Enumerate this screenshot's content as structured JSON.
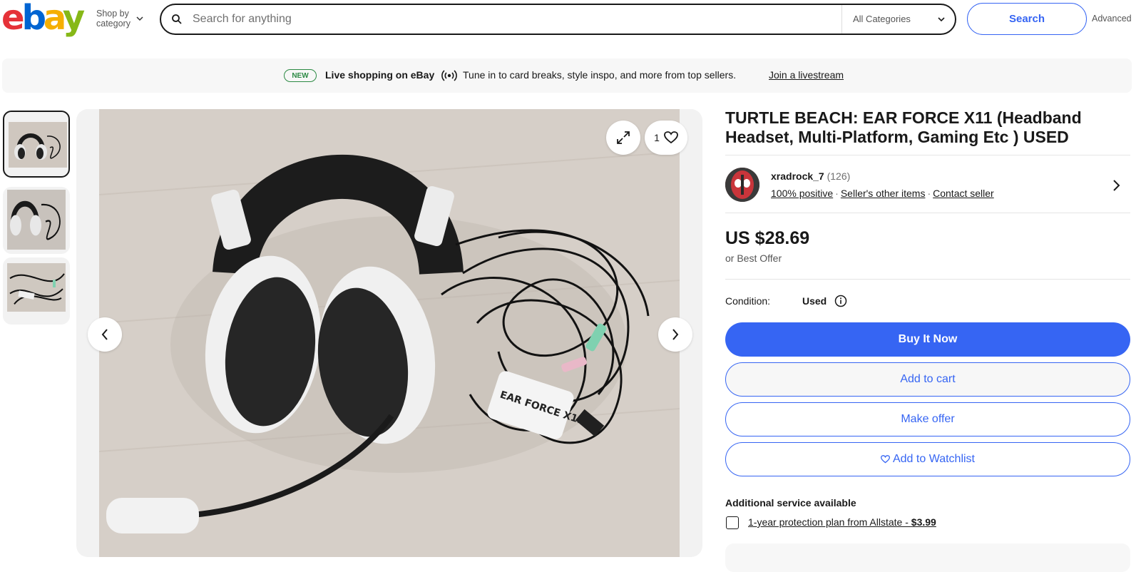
{
  "header": {
    "logo": [
      "e",
      "b",
      "a",
      "y"
    ],
    "shop_by_line1": "Shop by",
    "shop_by_line2": "category",
    "search_placeholder": "Search for anything",
    "category": "All Categories",
    "search_button": "Search",
    "advanced": "Advanced"
  },
  "banner": {
    "badge": "NEW",
    "title": "Live shopping on eBay",
    "text": "Tune in to card breaks, style inspo, and more from top sellers.",
    "link": "Join a livestream"
  },
  "gallery": {
    "favorite_count": "1"
  },
  "listing": {
    "title": "TURTLE BEACH: EAR FORCE X11 (Headband Headset, Multi-Platform, Gaming Etc ) USED",
    "seller": {
      "name": "xradrock_7",
      "count": "(126)",
      "positive": "100% positive",
      "other_items": "Seller's other items",
      "contact": "Contact seller"
    },
    "price": "US $28.69",
    "best_offer": "or Best Offer",
    "condition_label": "Condition:",
    "condition_value": "Used",
    "buttons": {
      "buy_now": "Buy It Now",
      "add_cart": "Add to cart",
      "make_offer": "Make offer",
      "watchlist": "Add to Watchlist"
    },
    "additional_service": "Additional service available",
    "protection_text": "1-year protection plan from Allstate - ",
    "protection_price": "$3.99"
  },
  "colors": {
    "primary": "#3665f3",
    "text": "#191919",
    "new_green": "#2c8a44"
  }
}
